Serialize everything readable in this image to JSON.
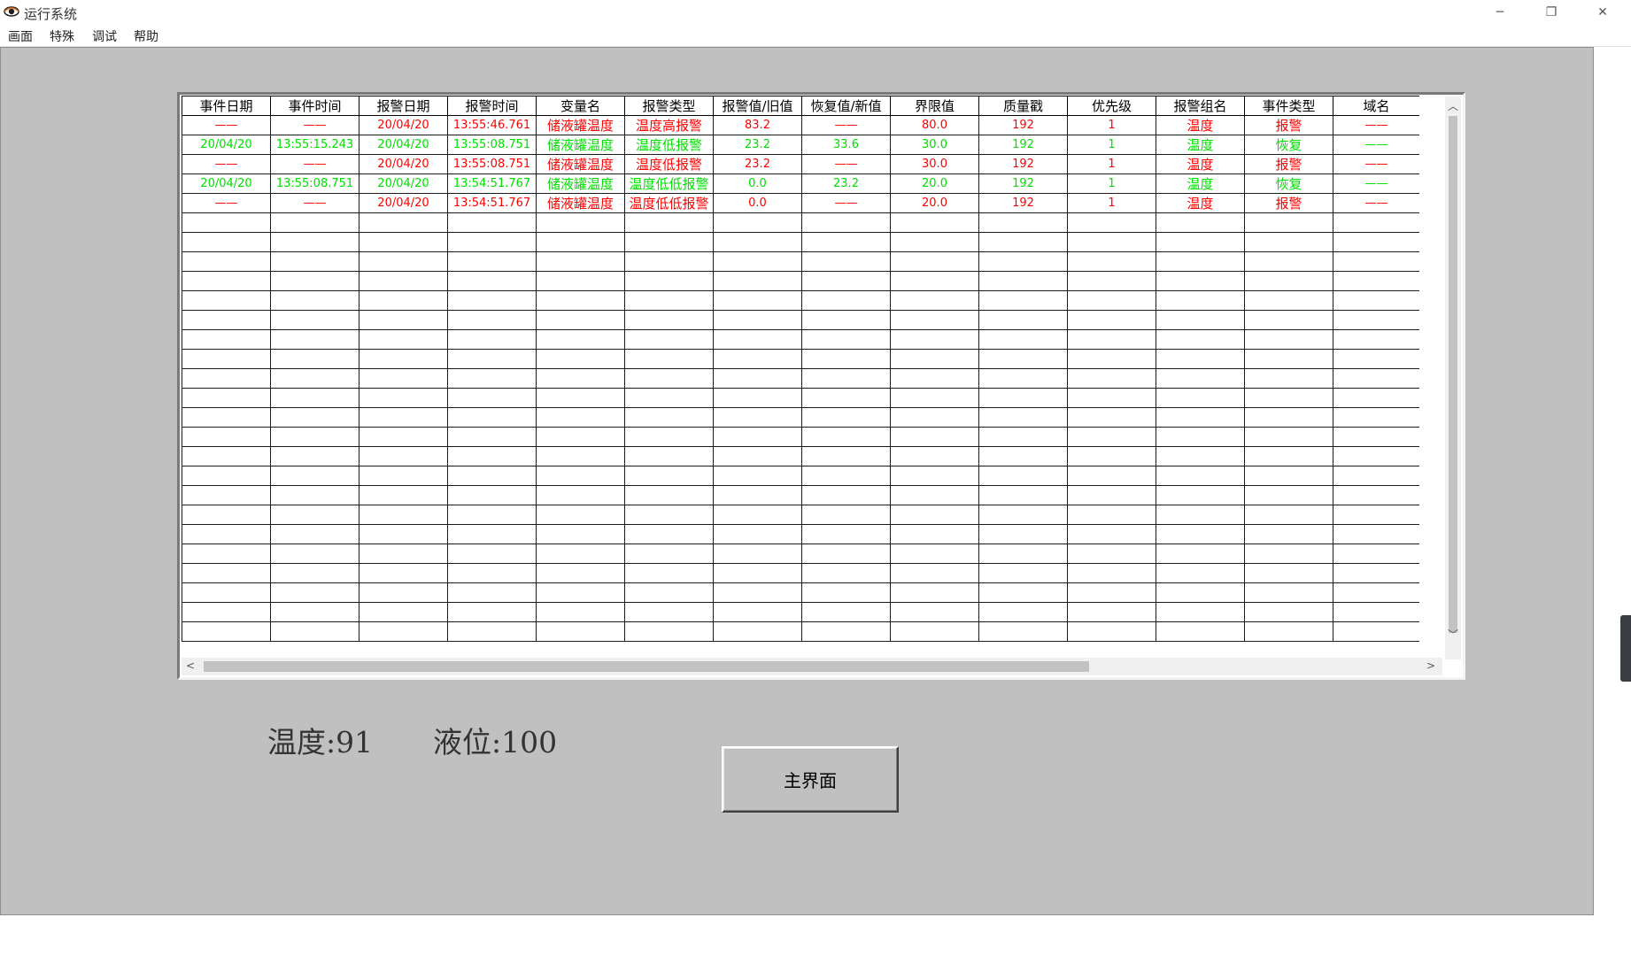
{
  "window": {
    "title": "运行系统",
    "min_glyph": "─",
    "max_glyph": "❐",
    "close_glyph": "✕"
  },
  "menu": [
    "画面",
    "特殊",
    "调试",
    "帮助"
  ],
  "alarm_table": {
    "columns": [
      "事件日期",
      "事件时间",
      "报警日期",
      "报警时间",
      "变量名",
      "报警类型",
      "报警值/旧值",
      "恢复值/新值",
      "界限值",
      "质量戳",
      "优先级",
      "报警组名",
      "事件类型",
      "域名"
    ],
    "rows": [
      {
        "status": "red",
        "cells": [
          "——",
          "——",
          "20/04/20",
          "13:55:46.761",
          "储液罐温度",
          "温度高报警",
          "83.2",
          "——",
          "80.0",
          "192",
          "1",
          "温度",
          "报警",
          "——"
        ]
      },
      {
        "status": "green",
        "cells": [
          "20/04/20",
          "13:55:15.243",
          "20/04/20",
          "13:55:08.751",
          "储液罐温度",
          "温度低报警",
          "23.2",
          "33.6",
          "30.0",
          "192",
          "1",
          "温度",
          "恢复",
          "——"
        ]
      },
      {
        "status": "red",
        "cells": [
          "——",
          "——",
          "20/04/20",
          "13:55:08.751",
          "储液罐温度",
          "温度低报警",
          "23.2",
          "——",
          "30.0",
          "192",
          "1",
          "温度",
          "报警",
          "——"
        ]
      },
      {
        "status": "green",
        "cells": [
          "20/04/20",
          "13:55:08.751",
          "20/04/20",
          "13:54:51.767",
          "储液罐温度",
          "温度低低报警",
          "0.0",
          "23.2",
          "20.0",
          "192",
          "1",
          "温度",
          "恢复",
          "——"
        ]
      },
      {
        "status": "red",
        "cells": [
          "——",
          "——",
          "20/04/20",
          "13:54:51.767",
          "储液罐温度",
          "温度低低报警",
          "0.0",
          "——",
          "20.0",
          "192",
          "1",
          "温度",
          "报警",
          "——"
        ]
      }
    ],
    "empty_row_count": 22
  },
  "readouts": {
    "temperature": "温度:91",
    "level": "液位:100"
  },
  "main_button_label": "主界面",
  "colors": {
    "alarm": "#ff0000",
    "recovered": "#00e000",
    "panel": "#c0c0c0"
  }
}
